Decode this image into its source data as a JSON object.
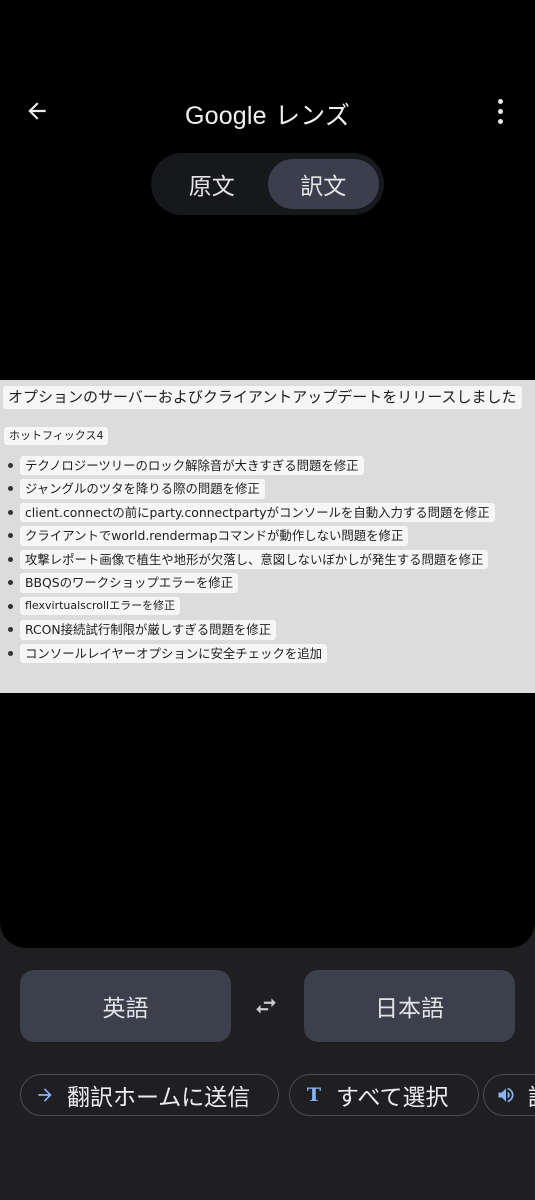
{
  "header": {
    "brand": "Google",
    "title_suffix": "レンズ"
  },
  "mode_toggle": {
    "original_label": "原文",
    "translated_label": "訳文",
    "selected": "訳文"
  },
  "translated_doc": {
    "title": "オプションのサーバーおよびクライアントアップデートをリリースしました",
    "subtitle": "ホットフィックス4",
    "items": [
      "テクノロジーツリーのロック解除音が大きすぎる問題を修正",
      "ジャングルのツタを降りる際の問題を修正",
      "client.connectの前にparty.connectpartyがコンソールを自動入力する問題を修正",
      "クライアントでworld.rendermapコマンドが動作しない問題を修正",
      "攻撃レポート画像で植生や地形が欠落し、意図しないぼかしが発生する問題を修正",
      "BBQSのワークショップエラーを修正",
      "flexvirtualscrollエラーを修正",
      "RCON接続試行制限が厳しすぎる問題を修正",
      "コンソールレイヤーオプションに安全チェックを追加"
    ]
  },
  "languages": {
    "source": "英語",
    "target": "日本語"
  },
  "actions": {
    "send_to_translate": "翻訳ホームに送信",
    "select_all": "すべて選択",
    "listen": "読"
  },
  "colors": {
    "accent_blue": "#8ab4f8",
    "button_bg": "#3c404d",
    "panel_bg": "#1f1f22"
  },
  "icons": {
    "back": "arrow-left-icon",
    "menu": "more-vert-icon",
    "swap": "swap-horiz-icon",
    "send": "arrow-right-icon",
    "select": "text-t-icon",
    "listen": "speaker-icon"
  }
}
